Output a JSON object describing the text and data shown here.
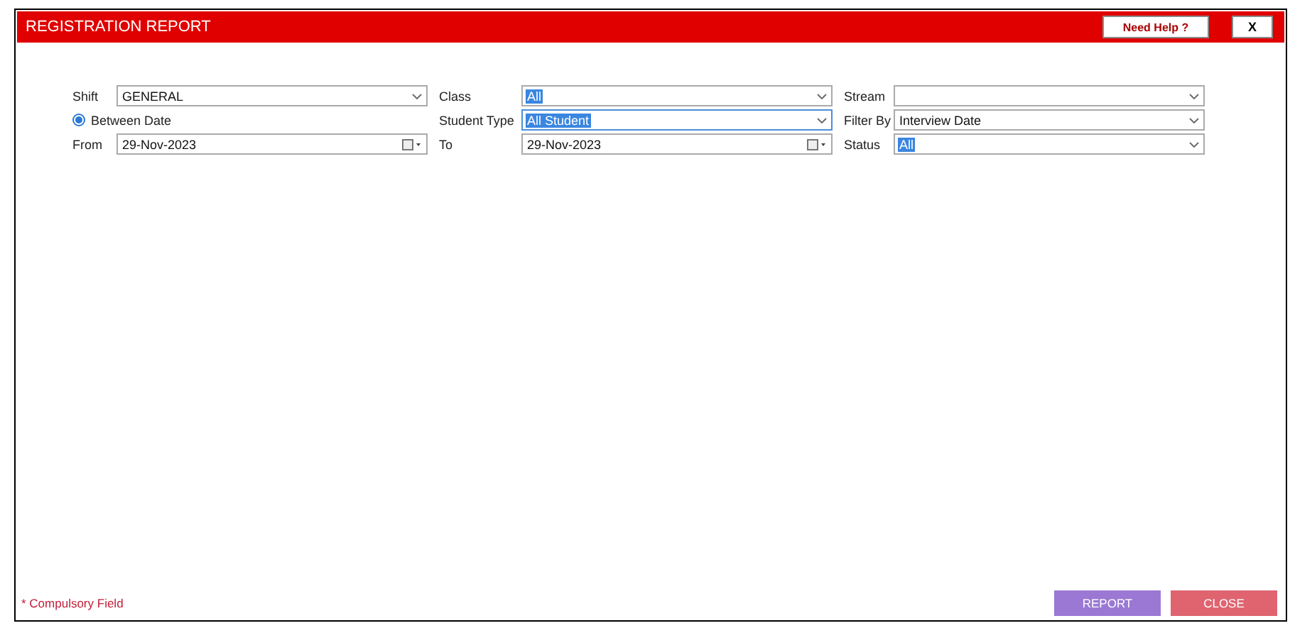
{
  "window": {
    "title": "REGISTRATION REPORT",
    "help_button": "Need Help ?",
    "close_icon": "X"
  },
  "form_rows": [
    [
      {
        "kind": "dropdown",
        "label": "Shift",
        "value": "GENERAL",
        "text_selected": false,
        "focused": false
      },
      {
        "kind": "dropdown",
        "label": "Class",
        "value": "All",
        "text_selected": true,
        "focused": false
      },
      {
        "kind": "dropdown",
        "label": "Stream",
        "focused": false
      }
    ],
    [
      {
        "kind": "radio",
        "label": "Between Date",
        "selected": true
      },
      {
        "kind": "dropdown",
        "label": "Student Type",
        "value": "All Student",
        "text_selected": true,
        "focused": true
      },
      {
        "kind": "dropdown",
        "label": "Filter By",
        "value": "Interview Date",
        "text_selected": false,
        "focused": false
      }
    ],
    [
      {
        "kind": "date",
        "label": "From",
        "value": "29-Nov-2023",
        "text_selected": false,
        "focused": false
      },
      {
        "kind": "date",
        "label": "To",
        "value": "29-Nov-2023",
        "text_selected": false,
        "focused": false
      },
      {
        "kind": "dropdown",
        "label": "Status",
        "value": "All",
        "text_selected": true,
        "focused": false
      }
    ]
  ],
  "footer": {
    "note": "* Compulsory Field",
    "buttons": [
      {
        "label": "REPORT",
        "kind": "primary"
      },
      {
        "label": "CLOSE",
        "kind": "danger"
      }
    ]
  }
}
